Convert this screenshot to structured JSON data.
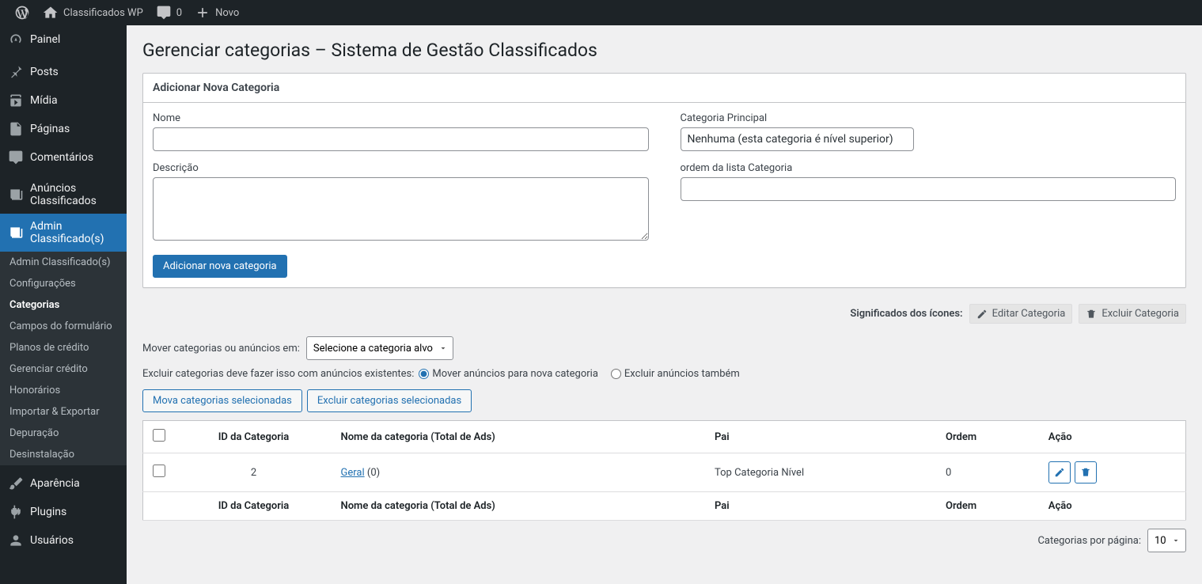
{
  "adminbar": {
    "site_name": "Classificados WP",
    "comments_count": "0",
    "new_label": "Novo"
  },
  "sidebar": {
    "items": [
      {
        "id": "dashboard",
        "label": "Painel"
      },
      {
        "id": "posts",
        "label": "Posts"
      },
      {
        "id": "media",
        "label": "Mídia"
      },
      {
        "id": "pages",
        "label": "Páginas"
      },
      {
        "id": "comments",
        "label": "Comentários"
      },
      {
        "id": "ads",
        "label": "Anúncios Classificados"
      },
      {
        "id": "admin-classificados",
        "label": "Admin Classificado(s)"
      },
      {
        "id": "appearance",
        "label": "Aparência"
      },
      {
        "id": "plugins",
        "label": "Plugins"
      },
      {
        "id": "users",
        "label": "Usuários"
      }
    ],
    "submenu": [
      "Admin Classificado(s)",
      "Configurações",
      "Categorias",
      "Campos do formulário",
      "Planos de crédito",
      "Gerenciar crédito",
      "Honorários",
      "Importar & Exportar",
      "Depuração",
      "Desinstalação"
    ],
    "submenu_current_index": 2
  },
  "page": {
    "title": "Gerenciar categorias – Sistema de Gestão Classificados",
    "postbox_title": "Adicionar Nova Categoria",
    "labels": {
      "name": "Nome",
      "parent": "Categoria Principal",
      "parent_option": "Nenhuma (esta categoria é nível superior)",
      "description": "Descrição",
      "order": "ordem da lista Categoria",
      "submit": "Adicionar nova categoria"
    },
    "legend": {
      "title": "Significados dos ícones:",
      "edit": "Editar Categoria",
      "delete": "Excluir Categoria"
    },
    "filters": {
      "move_label": "Mover categorias ou anúncios em:",
      "target_option": "Selecione a categoria alvo",
      "delete_label": "Excluir categorias deve fazer isso com anúncios existentes:",
      "radio_move": "Mover anúncios para nova categoria",
      "radio_delete": "Excluir anúncios também",
      "bulk_move": "Mova categorias selecionadas",
      "bulk_delete": "Excluir categorias selecionadas"
    },
    "table": {
      "headers": {
        "id": "ID da Categoria",
        "name": "Nome da categoria (Total de Ads)",
        "parent": "Pai",
        "order": "Ordem",
        "action": "Ação"
      },
      "rows": [
        {
          "id": "2",
          "name": "Geral",
          "ads": "(0)",
          "parent": "Top Categoria Nível",
          "order": "0"
        }
      ]
    },
    "pagination": {
      "label": "Categorias por página:",
      "value": "10"
    }
  }
}
